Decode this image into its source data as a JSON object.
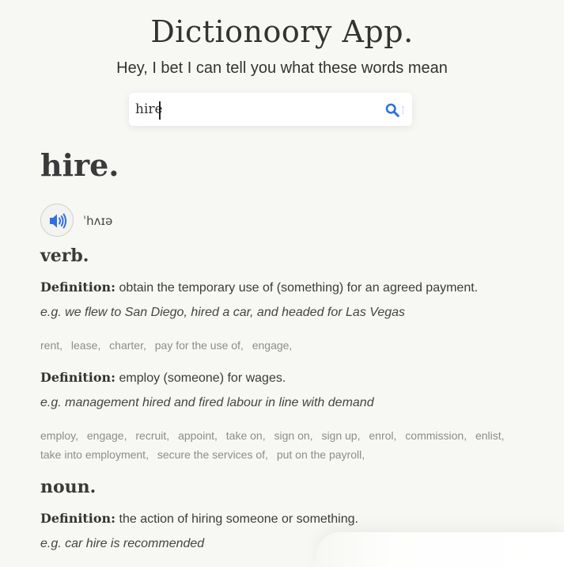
{
  "app": {
    "title": "Dictionoory App.",
    "tagline": "Hey, I bet I can tell you what these words mean"
  },
  "search": {
    "value": "hire",
    "icon": "search-icon",
    "accent_color": "#2f6fe4"
  },
  "entry": {
    "word": "hire.",
    "phonetic": "ˈhʌɪə",
    "audio_icon": "speaker-icon",
    "meanings": [
      {
        "part_of_speech": "verb.",
        "definitions": [
          {
            "label": "Definition:",
            "text": "obtain the temporary use of (something) for an agreed payment.",
            "example": "e.g. we flew to San Diego, hired a car, and headed for Las Vegas",
            "synonyms": [
              "rent,",
              "lease,",
              "charter,",
              "pay for the use of,",
              "engage,"
            ]
          },
          {
            "label": "Definition:",
            "text": "employ (someone) for wages.",
            "example": "e.g. management hired and fired labour in line with demand",
            "synonyms": [
              "employ,",
              "engage,",
              "recruit,",
              "appoint,",
              "take on,",
              "sign on,",
              "sign up,",
              "enrol,",
              "commission,",
              "enlist,",
              "take into employment,",
              "secure the services of,",
              "put on the payroll,"
            ]
          }
        ]
      },
      {
        "part_of_speech": "noun.",
        "definitions": [
          {
            "label": "Definition:",
            "text": "the action of hiring someone or something.",
            "example": "e.g. car hire is recommended",
            "synonyms": []
          }
        ]
      }
    ]
  }
}
